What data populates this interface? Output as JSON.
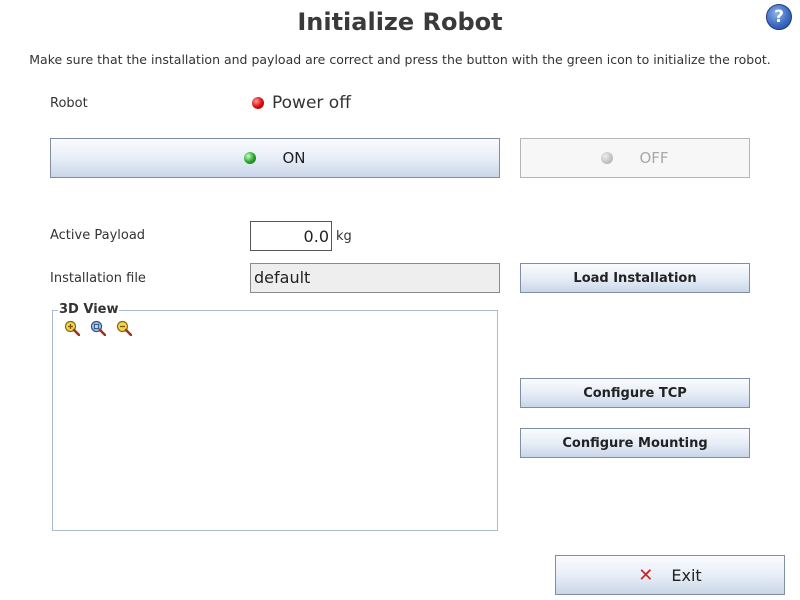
{
  "title": "Initialize Robot",
  "help": {
    "symbol": "?"
  },
  "instruction": "Make sure that the installation and payload are correct and press the button with the green icon to initialize the robot.",
  "robot": {
    "label": "Robot",
    "status_text": "Power off",
    "status_icon": "red-led-icon"
  },
  "power": {
    "on_label": "ON",
    "on_icon": "green-led-icon",
    "off_label": "OFF",
    "off_icon": "gray-led-icon"
  },
  "payload": {
    "label": "Active Payload",
    "value": "0.0",
    "unit": "kg"
  },
  "installation": {
    "label": "Installation file",
    "value": "default",
    "load_label": "Load Installation"
  },
  "view3d": {
    "legend": "3D View",
    "icons": [
      "zoom-in-icon",
      "zoom-fit-icon",
      "zoom-out-icon"
    ]
  },
  "buttons": {
    "configure_tcp": "Configure TCP",
    "configure_mounting": "Configure Mounting",
    "exit": "Exit",
    "exit_icon": "close-x-icon"
  },
  "colors": {
    "accent_green": "#2fa82f",
    "status_red": "#e01010",
    "exit_red": "#c0281f",
    "help_blue": "#3d6cc4"
  }
}
